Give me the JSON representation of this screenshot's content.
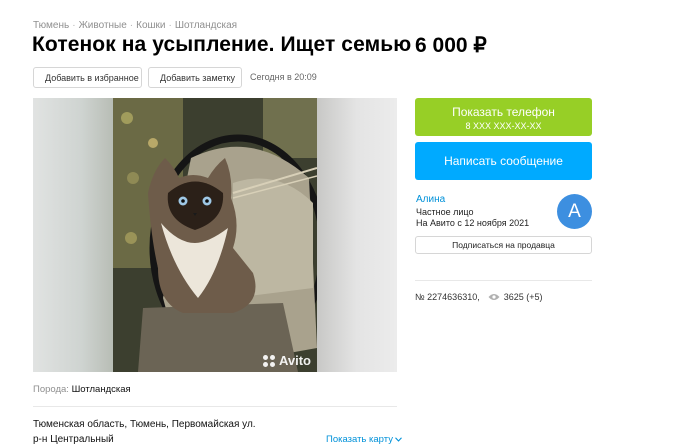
{
  "breadcrumbs": [
    "Тюмень",
    "Животные",
    "Кошки",
    "Шотландская"
  ],
  "breadcrumb_separator": "·",
  "title": "Котенок на усыпление. Ищет семью",
  "price": "6 000 ₽",
  "actions": {
    "favorite_label": "Добавить в избранное",
    "note_label": "Добавить заметку"
  },
  "posted": "Сегодня в 20:09",
  "gallery": {
    "watermark": "Avito"
  },
  "contact": {
    "phone_button_label": "Показать телефон",
    "phone_masked": "8 XXX XXX-XX-XX",
    "message_button_label": "Написать сообщение"
  },
  "seller": {
    "name": "Алина",
    "type": "Частное лицо",
    "since": "На Авито с 12 ноября 2021",
    "avatar_letter": "A",
    "subscribe_label": "Подписаться на продавца"
  },
  "ad_meta": {
    "number": "№ 2274636310,",
    "views": "3625 (+5)"
  },
  "params": {
    "breed_key": "Порода:",
    "breed_value": "Шотландская"
  },
  "location": {
    "address_line1": "Тюменская область, Тюмень, Первомайская ул.",
    "address_line2": "р-н Центральный",
    "map_link": "Показать карту"
  },
  "colors": {
    "phone_button": "#97cf26",
    "message_button": "#00aaff",
    "link": "#0091d9",
    "avatar": "#3d8fe0"
  },
  "icons": [
    "heart-icon",
    "note-icon",
    "eye-icon",
    "chevron-down-icon",
    "avito-logo-icon"
  ]
}
